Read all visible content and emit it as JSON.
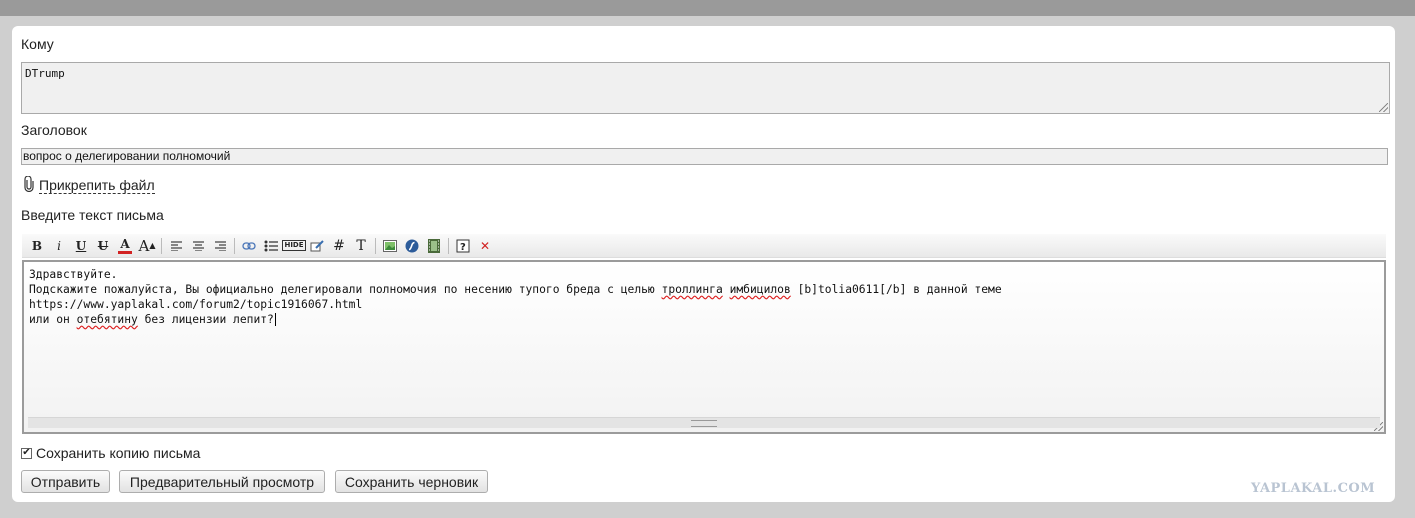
{
  "form": {
    "to_label": "Кому",
    "to_value": "DTrump",
    "subject_label": "Заголовок",
    "subject_value": "вопрос о делегировании полномочий",
    "attach_label": "Прикрепить файл",
    "message_label": "Введите текст письма",
    "message_lines": {
      "line1": "Здравствуйте.",
      "line2_a": "Подскажите пожалуйста, Вы официально делегировали полномочия по несению тупого бреда с целью ",
      "line2_w1": "троллинга",
      "line2_sp": " ",
      "line2_w2": "имбицилов",
      "line2_b": " [b]tolia0611[/b] в данной теме",
      "line3": "https://www.yaplakal.com/forum2/topic1916067.html",
      "line4_a": "или он ",
      "line4_w": "отебятину",
      "line4_b": " без лицензии лепит?"
    },
    "save_copy_label": "Сохранить копию письма",
    "save_copy_checked": true
  },
  "toolbar": {
    "bold": "B",
    "italic": "i",
    "underline": "U",
    "strike": "U",
    "font_color": "A",
    "font_size": "A",
    "hash": "#",
    "typography": "T",
    "hide": "HIDE",
    "icons": [
      "bold-icon",
      "italic-icon",
      "underline-icon",
      "strikethrough-icon",
      "font-color-icon",
      "font-size-icon",
      "align-left-icon",
      "align-center-icon",
      "align-right-icon",
      "link-icon",
      "list-icon",
      "hide-icon",
      "edit-icon",
      "hash-icon",
      "typography-icon",
      "image-icon",
      "flash-icon",
      "video-icon",
      "help-icon",
      "clear-icon"
    ]
  },
  "buttons": {
    "send": "Отправить",
    "preview": "Предварительный просмотр",
    "save_draft": "Сохранить черновик"
  },
  "watermark": "YAPLAKAL.COM",
  "colors": {
    "accent_red": "#d22222",
    "watermark": "#b9c4d2"
  }
}
